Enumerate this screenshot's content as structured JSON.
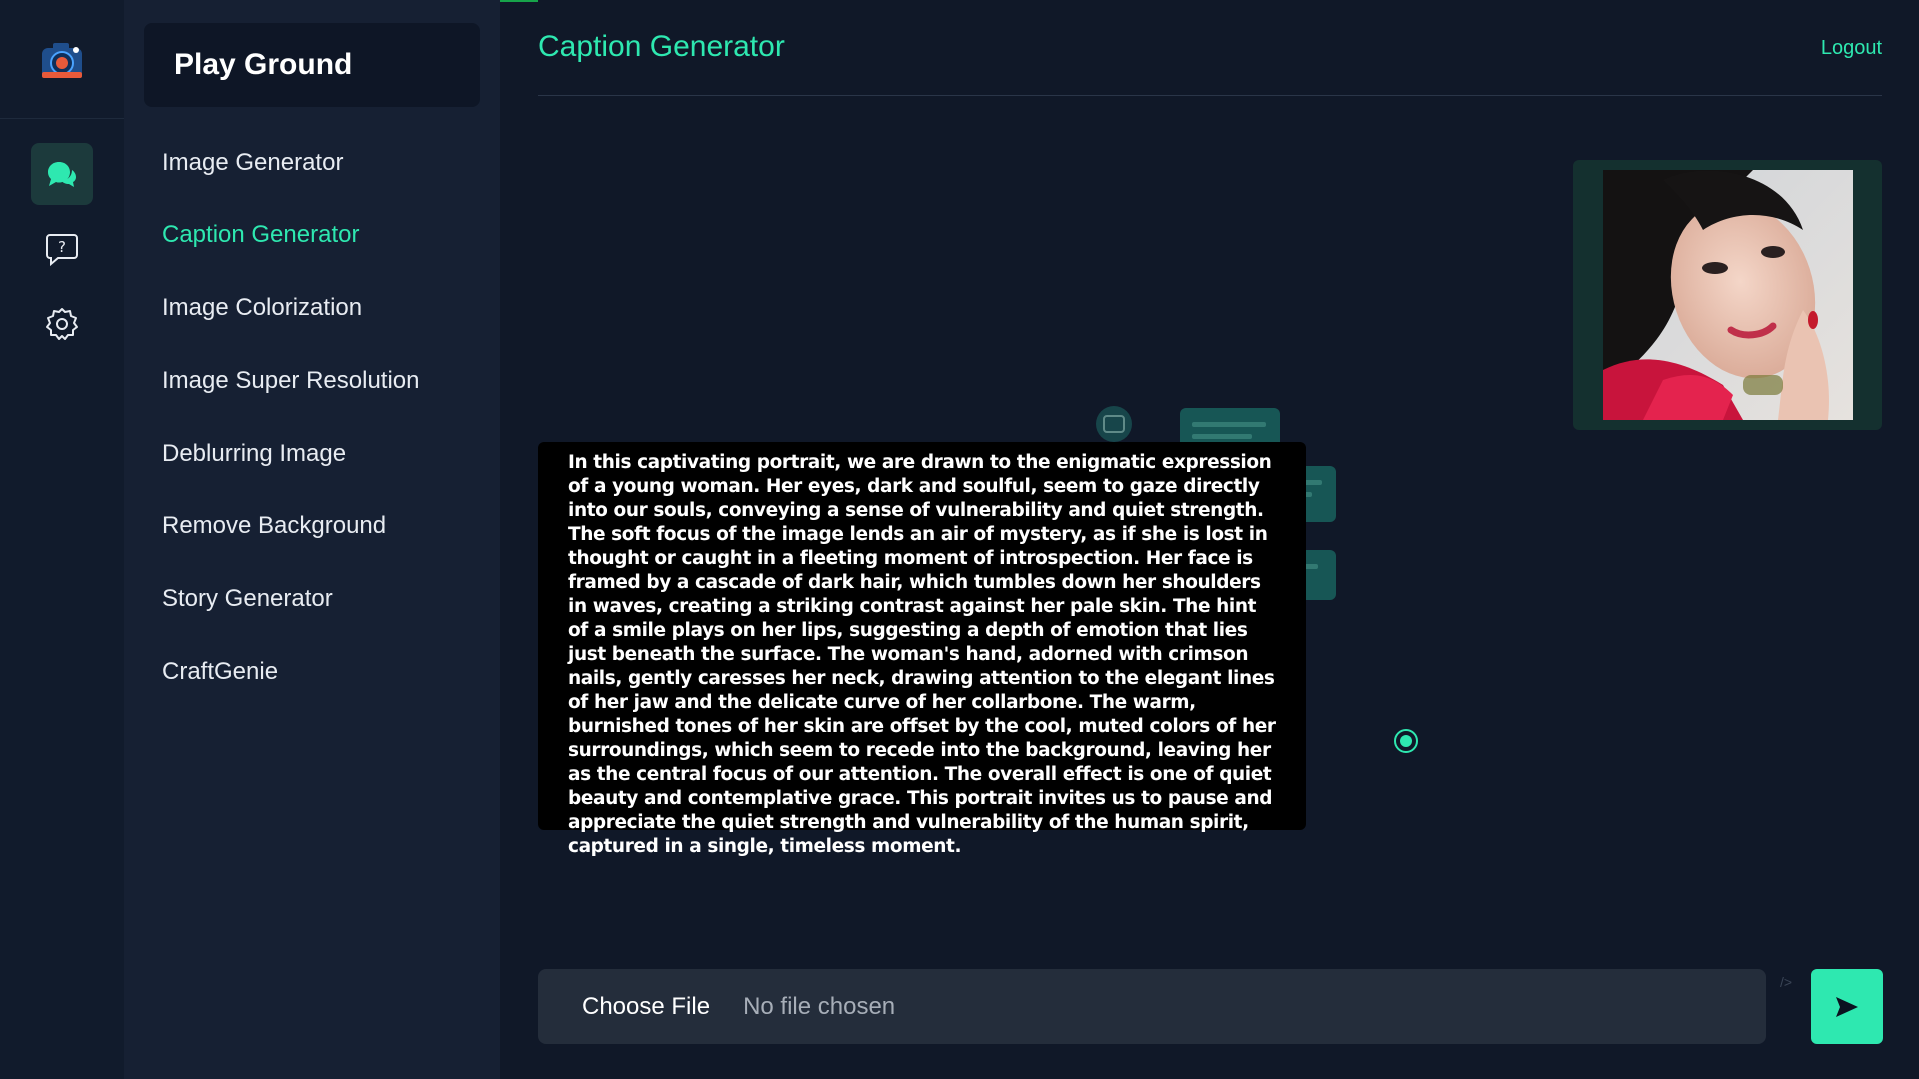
{
  "sidebar": {
    "title": "Play Ground",
    "items": [
      {
        "label": "Image Generator"
      },
      {
        "label": "Caption Generator"
      },
      {
        "label": "Image Colorization"
      },
      {
        "label": "Image Super Resolution"
      },
      {
        "label": "Deblurring Image"
      },
      {
        "label": "Remove Background"
      },
      {
        "label": "Story Generator"
      },
      {
        "label": "CraftGenie"
      }
    ],
    "active_index": 1
  },
  "rail": {
    "icons": [
      "camera-logo-icon",
      "chat-bubbles-icon",
      "help-question-icon",
      "settings-gear-icon"
    ]
  },
  "header": {
    "title": "Caption Generator",
    "logout_label": "Logout"
  },
  "caption": {
    "text": "In this captivating portrait, we are drawn to the enigmatic expression of a young woman. Her eyes, dark and soulful, seem to gaze directly into our souls, conveying a sense of vulnerability and quiet strength. The soft focus of the image lends an air of mystery, as if she is lost in thought or caught in a fleeting moment of introspection. Her face is framed by a cascade of dark hair, which tumbles down her shoulders in waves, creating a striking contrast against her pale skin. The hint of a smile plays on her lips, suggesting a depth of emotion that lies just beneath the surface. The woman's hand, adorned with crimson nails, gently caresses her neck, drawing attention to the elegant lines of her jaw and the delicate curve of her collarbone. The warm, burnished tones of her skin are offset by the cool, muted colors of her surroundings, which seem to recede into the background, leaving her as the central focus of our attention. The overall effect is one of quiet beauty and contemplative grace. This portrait invites us to pause and appreciate the quiet strength and vulnerability of the human spirit, captured in a single, timeless moment."
  },
  "upload": {
    "choose_label": "Choose File",
    "status": "No file chosen",
    "tag": "/>"
  },
  "colors": {
    "accent": "#2ee8b0",
    "background": "#101828",
    "sidebar": "#162033"
  }
}
